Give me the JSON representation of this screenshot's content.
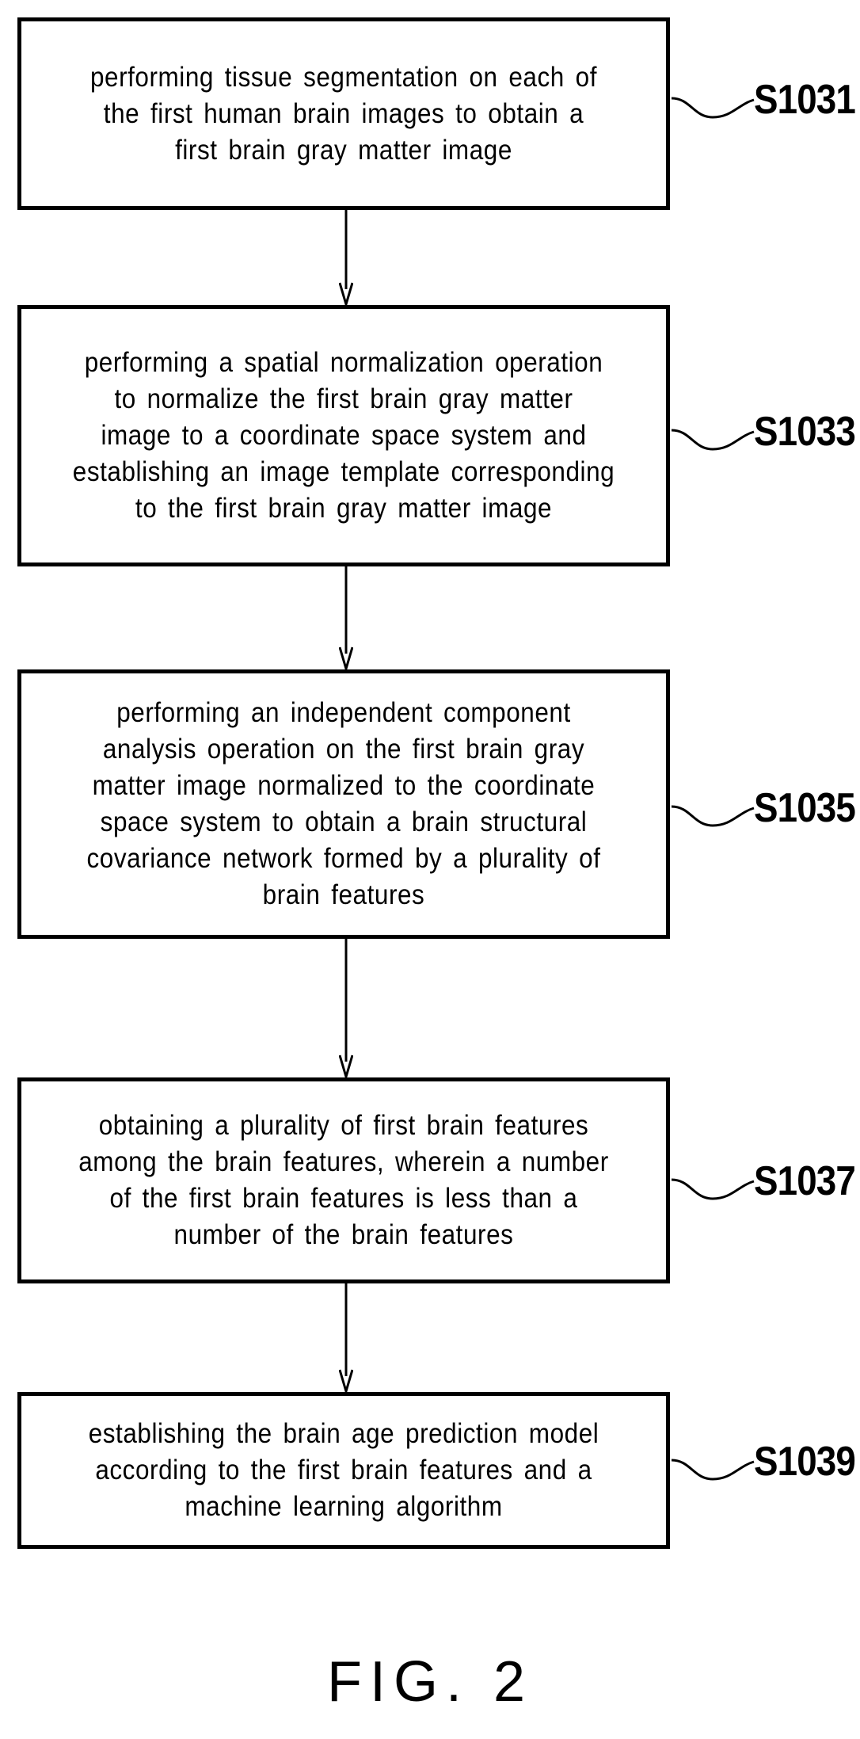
{
  "figure": {
    "caption": "FIG. 2",
    "type": "flowchart",
    "orientation": "vertical-top-to-bottom"
  },
  "flowchart": {
    "steps": [
      {
        "ref": "S1031",
        "text": "performing tissue segmentation on each of\nthe first human brain images to obtain a\nfirst brain gray matter image"
      },
      {
        "ref": "S1033",
        "text": "performing a spatial normalization operation\nto normalize the first brain gray matter\nimage to a coordinate space system and\nestablishing an image template corresponding\nto the first brain gray matter image"
      },
      {
        "ref": "S1035",
        "text": "performing an independent component\nanalysis operation on the first brain gray\nmatter image normalized to the coordinate\nspace system to obtain a brain structural\ncovariance network formed by a plurality of\nbrain features"
      },
      {
        "ref": "S1037",
        "text": "obtaining a plurality of first brain features\namong the brain features, wherein a number\nof the first brain features is less than a\nnumber of the brain features"
      },
      {
        "ref": "S1039",
        "text": "establishing the brain age prediction model\naccording to the first brain features and a\nmachine learning algorithm"
      }
    ],
    "connector_count": 4,
    "colors": {
      "line": "#000000",
      "background": "#ffffff",
      "text": "#000000"
    }
  }
}
